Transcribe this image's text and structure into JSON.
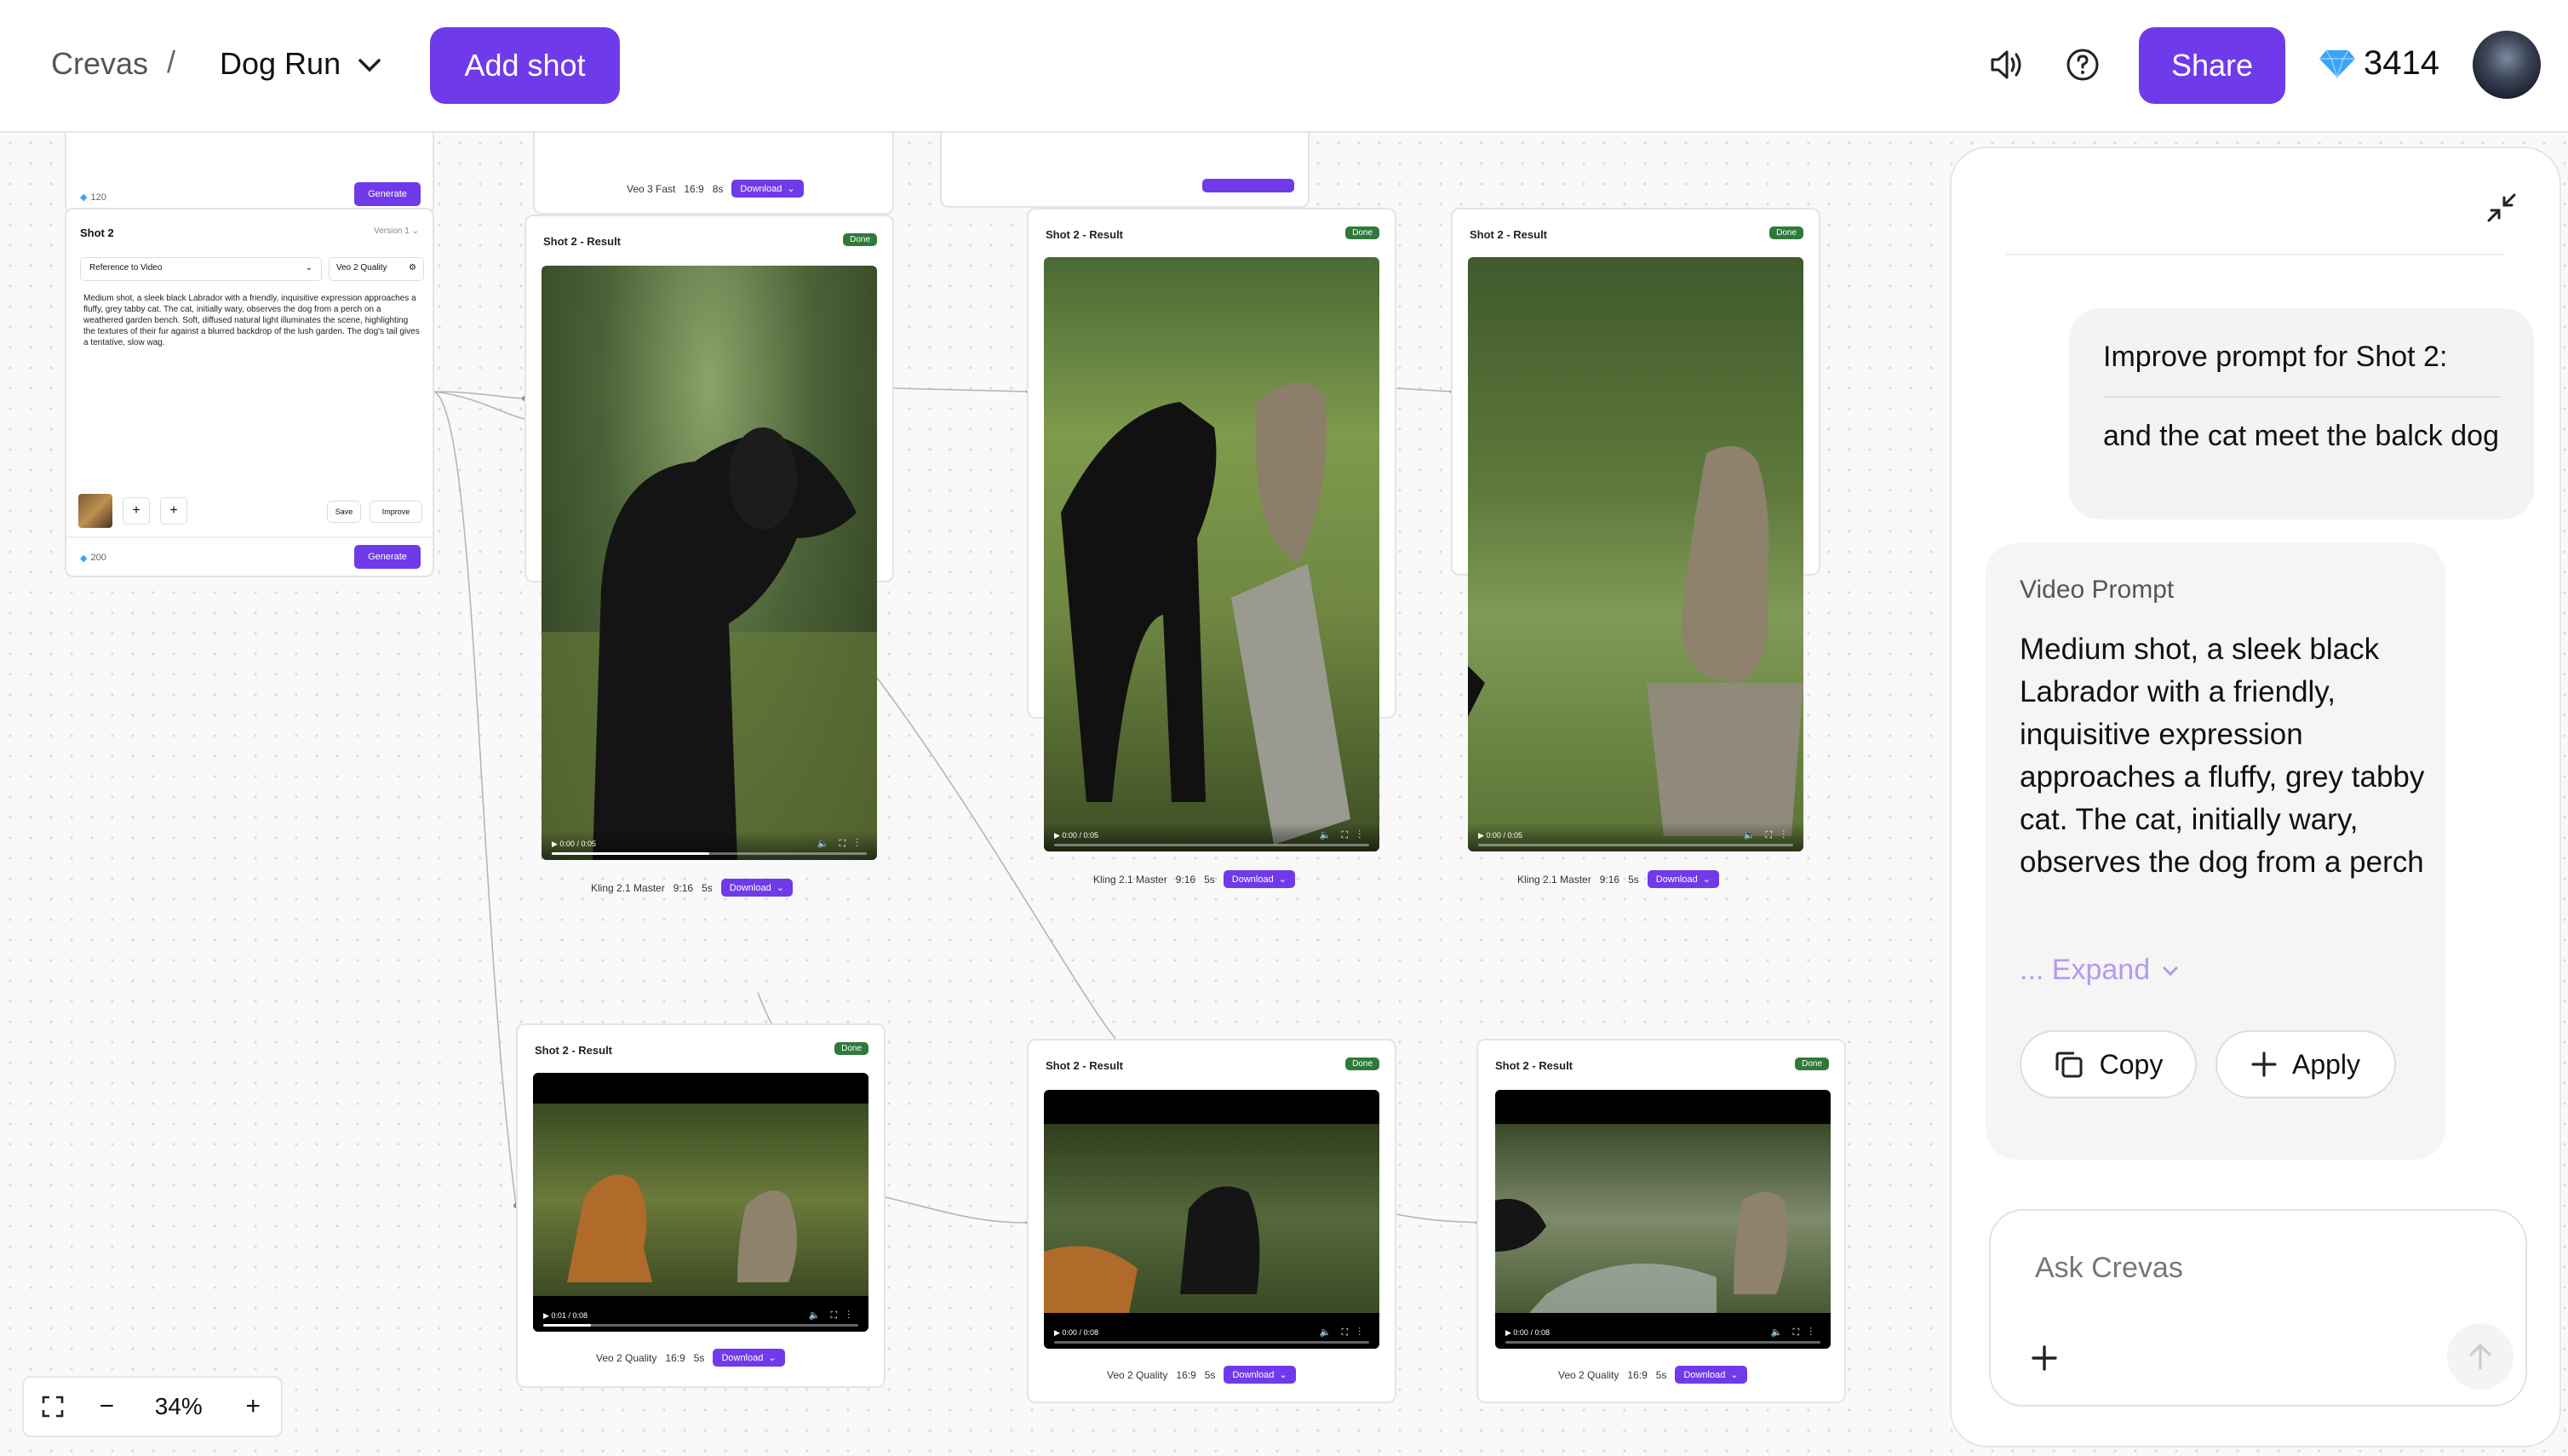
{
  "header": {
    "breadcrumb_root": "Crevas",
    "breadcrumb_sep": "/",
    "project_name": "Dog Run",
    "add_shot_label": "Add shot",
    "share_label": "Share",
    "credits": "3414"
  },
  "canvas": {
    "top_left_card": {
      "credits": "120",
      "generate_label": "Generate"
    },
    "top_middle_meta": {
      "model": "Veo 3 Fast",
      "ratio": "16:9",
      "duration": "8s",
      "download": "Download"
    },
    "shot_card": {
      "title": "Shot 2",
      "version": "Version 1",
      "mode": "Reference to Video",
      "model": "Veo 2 Quality",
      "prompt": "Medium shot, a sleek black Labrador with a friendly, inquisitive expression approaches a fluffy, grey tabby cat. The cat, initially wary, observes the dog from a perch on a weathered garden bench. Soft, diffused natural light illuminates the scene, highlighting the textures of their fur against a blurred backdrop of the lush garden. The dog's tail gives a tentative, slow wag.",
      "save_label": "Save",
      "improve_label": "Improve",
      "credits": "200",
      "generate_label": "Generate"
    },
    "results": [
      {
        "title": "Shot 2 - Result",
        "status": "Done",
        "time": "0:00 / 0:05",
        "progress": 0.5,
        "model": "Kling 2.1 Master",
        "ratio": "9:16",
        "duration": "5s",
        "download": "Download"
      },
      {
        "title": "Shot 2 - Result",
        "status": "Done",
        "time": "0:00 / 0:05",
        "progress": 0.0,
        "model": "Kling 2.1 Master",
        "ratio": "9:16",
        "duration": "5s",
        "download": "Download"
      },
      {
        "title": "Shot 2 - Result",
        "status": "Done",
        "time": "0:00 / 0:05",
        "progress": 0.0,
        "model": "Kling 2.1 Master",
        "ratio": "9:16",
        "duration": "5s",
        "download": "Download"
      },
      {
        "title": "Shot 2 - Result",
        "status": "Done",
        "time": "0:01 / 0:08",
        "progress": 0.15,
        "model": "Veo 2 Quality",
        "ratio": "16:9",
        "duration": "5s",
        "download": "Download"
      },
      {
        "title": "Shot 2 - Result",
        "status": "Done",
        "time": "0:00 / 0:08",
        "progress": 0.0,
        "model": "Veo 2 Quality",
        "ratio": "16:9",
        "duration": "5s",
        "download": "Download"
      },
      {
        "title": "Shot 2 - Result",
        "status": "Done",
        "time": "0:00 / 0:08",
        "progress": 0.0,
        "model": "Veo 2 Quality",
        "ratio": "16:9",
        "duration": "5s",
        "download": "Download"
      }
    ],
    "zoom": "34%"
  },
  "chat": {
    "user_message_title": "Improve prompt for Shot 2:",
    "user_message_body": "and the cat meet the balck dog",
    "response_label": "Video Prompt",
    "response_text": "Medium shot, a sleek black Labrador with a friendly, inquisitive expression approaches a fluffy, grey tabby cat. The cat, initially wary, observes the dog from a perch on a weathered garden bench. Soft, diffuse...",
    "expand_label": "... Expand",
    "copy_label": "Copy",
    "apply_label": "Apply",
    "input_placeholder": "Ask Crevas"
  },
  "colors": {
    "accent": "#6f3bea",
    "done_badge": "#2f7a3a"
  }
}
